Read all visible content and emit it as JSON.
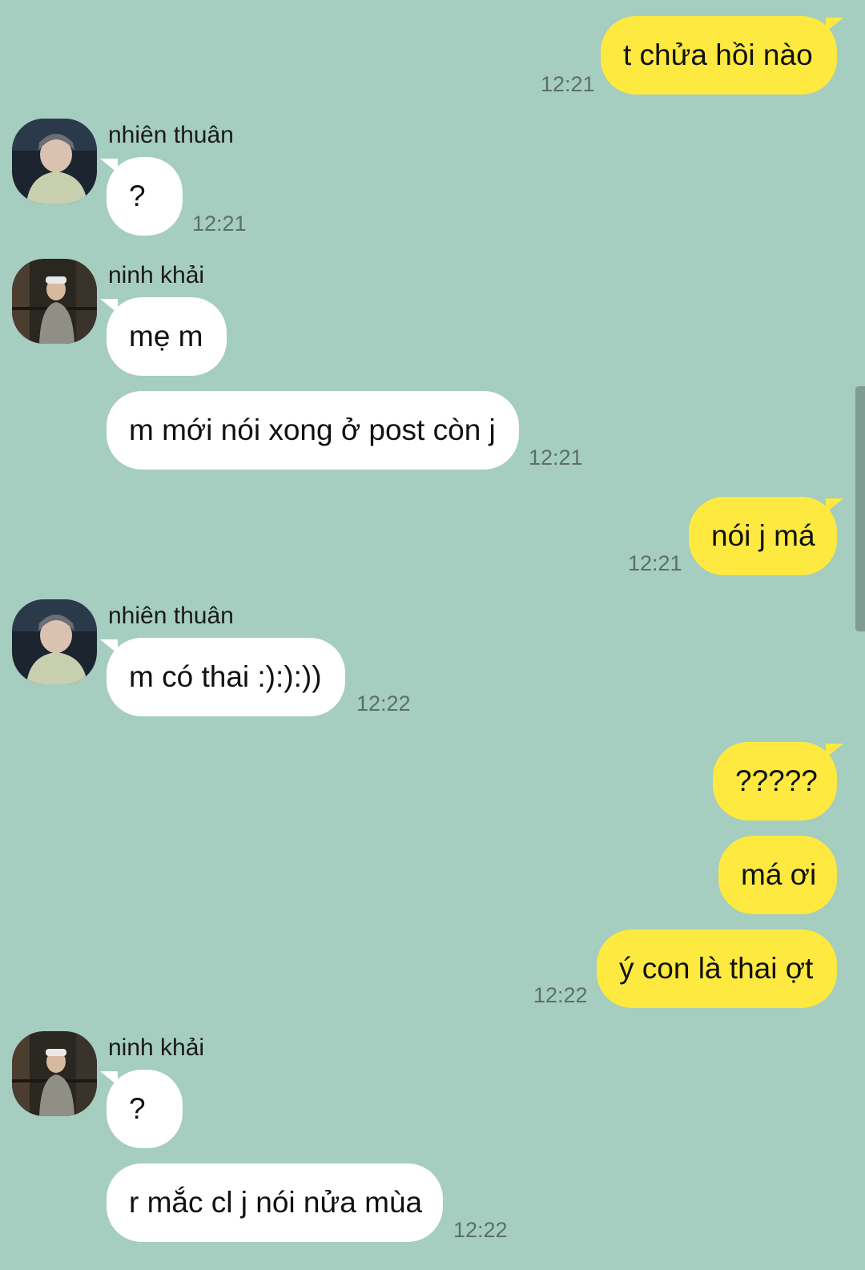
{
  "contacts": {
    "nhien_thuan": "nhiên thuân",
    "ninh_khai": "ninh khải"
  },
  "messages": [
    {
      "sender": "me",
      "text": "t chửa hồi nào",
      "time": "12:21"
    },
    {
      "sender": "nhiên thuân",
      "text": "?",
      "time": "12:21"
    },
    {
      "sender": "ninh khải",
      "text": "mẹ m",
      "time": ""
    },
    {
      "sender": "ninh khải",
      "text": "m mới nói xong ở post còn j",
      "time": "12:21"
    },
    {
      "sender": "me",
      "text": "nói j má",
      "time": "12:21"
    },
    {
      "sender": "nhiên thuân",
      "text": "m có thai :):):))",
      "time": "12:22"
    },
    {
      "sender": "me",
      "text": "?????",
      "time": ""
    },
    {
      "sender": "me",
      "text": "má ơi",
      "time": ""
    },
    {
      "sender": "me",
      "text": "ý con là thai ợt",
      "time": "12:22"
    },
    {
      "sender": "ninh khải",
      "text": "?",
      "time": ""
    },
    {
      "sender": "ninh khải",
      "text": "r mắc cl j nói nửa mùa",
      "time": "12:22"
    }
  ],
  "colors": {
    "background": "#a5cdc0",
    "incoming_bubble": "#ffffff",
    "outgoing_bubble": "#fde93f",
    "timestamp": "#5c6f68"
  }
}
